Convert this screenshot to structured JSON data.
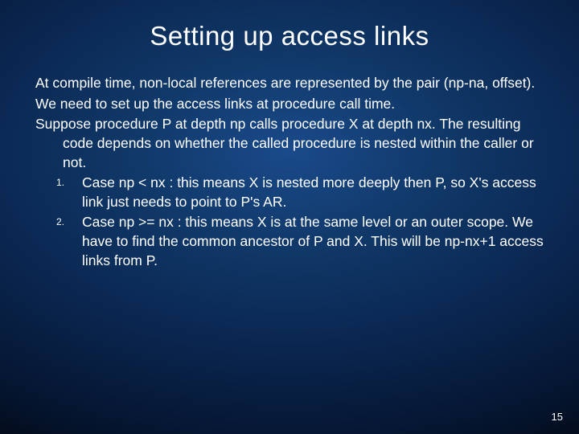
{
  "title": "Setting up access links",
  "paras": [
    "At compile time, non-local references are represented by the pair (np-na, offset).",
    "We need to set up the access links at procedure call time.",
    "Suppose procedure P at depth np calls procedure X at depth nx. The resulting code depends on whether the called procedure is nested within the caller or not."
  ],
  "items": [
    "Case np < nx : this means X is nested more deeply then P, so X's access link just needs to point to P's AR.",
    "Case np >= nx : this means X is at the same level or an outer scope. We have to find the common ancestor of P and X. This will be np-nx+1 access links from P."
  ],
  "pagenum": "15"
}
